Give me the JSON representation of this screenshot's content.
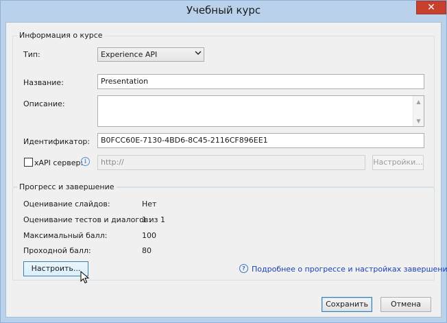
{
  "window": {
    "title": "Учебный курс",
    "close_glyph": "✕"
  },
  "course_info": {
    "group_label": "Информация о курсе",
    "type_label": "Тип:",
    "type_value": "Experience API",
    "name_label": "Название:",
    "name_value": "Presentation",
    "description_label": "Описание:",
    "description_value": "",
    "identifier_label": "Идентификатор:",
    "identifier_value": "B0FCC60E-7130-4BD6-8C45-2116CF896EE1",
    "xapi_label": "xAPI сервер:",
    "xapi_checked": false,
    "xapi_url_placeholder": "http://",
    "settings_button": "Настройки..."
  },
  "progress": {
    "group_label": "Прогресс и завершение",
    "rows": [
      {
        "label": "Оценивание слайдов:",
        "value": "Нет"
      },
      {
        "label": "Оценивание тестов и диалогов:",
        "value": "1 из 1"
      },
      {
        "label": "Максимальный балл:",
        "value": "100"
      },
      {
        "label": "Проходной балл:",
        "value": "80"
      }
    ],
    "configure_button": "Настроить...",
    "help_link": "Подробнее о прогрессе и настройках завершения"
  },
  "footer": {
    "save_button": "Сохранить",
    "cancel_button": "Отмена"
  },
  "icons": {
    "info": "info-icon",
    "help": "help-icon",
    "dropdown": "chevron-down-icon",
    "cursor": "mouse-pointer-icon"
  },
  "colors": {
    "title_bar": "#b9d1ea",
    "close_button": "#c7402e",
    "link": "#1a3fb4",
    "default_button_border": "#3c7fb1"
  }
}
